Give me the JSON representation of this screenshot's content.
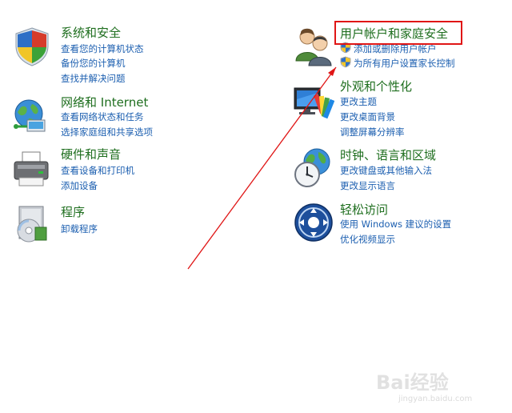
{
  "categories": {
    "system": {
      "title": "系统和安全",
      "links": [
        "查看您的计算机状态",
        "备份您的计算机",
        "查找并解决问题"
      ],
      "icon": "system-security-shield-icon"
    },
    "network": {
      "title": "网络和 Internet",
      "links": [
        "查看网络状态和任务",
        "选择家庭组和共享选项"
      ],
      "icon": "network-globe-icon"
    },
    "hardware": {
      "title": "硬件和声音",
      "links": [
        "查看设备和打印机",
        "添加设备"
      ],
      "icon": "printer-icon"
    },
    "programs": {
      "title": "程序",
      "links": [
        "卸载程序"
      ],
      "icon": "programs-disc-icon"
    },
    "users": {
      "title": "用户帐户和家庭安全",
      "links": [
        "添加或删除用户帐户",
        "为所有用户设置家长控制"
      ],
      "icon": "users-icon"
    },
    "appearance": {
      "title": "外观和个性化",
      "links": [
        "更改主题",
        "更改桌面背景",
        "调整屏幕分辨率"
      ],
      "icon": "appearance-monitor-icon"
    },
    "clock": {
      "title": "时钟、语言和区域",
      "links": [
        "更改键盘或其他输入法",
        "更改显示语言"
      ],
      "icon": "clock-globe-icon"
    },
    "ease": {
      "title": "轻松访问",
      "links": [
        "使用 Windows 建议的设置",
        "优化视频显示"
      ],
      "icon": "ease-of-access-icon"
    }
  },
  "watermark": {
    "logo": "Bai经验",
    "url": "jingyan.baidu.com"
  },
  "colors": {
    "title_green": "#1e6e1e",
    "link_blue": "#1c5fb0",
    "annotation_red": "#e01616"
  }
}
